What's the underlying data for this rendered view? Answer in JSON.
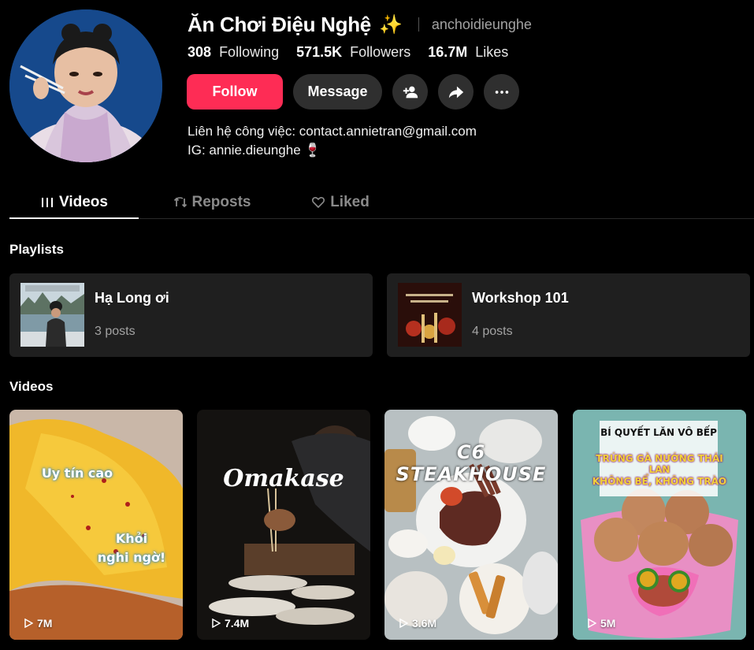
{
  "profile": {
    "display_name": "Ăn Chơi Điệu Nghệ",
    "badge_icon": "sparkles-icon",
    "username": "anchoidieunghe",
    "stats": {
      "following_count": "308",
      "following_label": "Following",
      "followers_count": "571.5K",
      "followers_label": "Followers",
      "likes_count": "16.7M",
      "likes_label": "Likes"
    },
    "bio": {
      "line1": "Liên hệ công việc: contact.annietran@gmail.com",
      "line2": "IG: annie.dieunghe",
      "line2_emoji": "🍷"
    }
  },
  "actions": {
    "follow_label": "Follow",
    "message_label": "Message",
    "add_friend_icon": "person-add-icon",
    "share_icon": "share-icon",
    "more_icon": "more-icon"
  },
  "tabs": [
    {
      "label": "Videos",
      "icon": "grid-icon",
      "active": true
    },
    {
      "label": "Reposts",
      "icon": "repost-icon",
      "active": false
    },
    {
      "label": "Liked",
      "icon": "heart-icon",
      "active": false
    }
  ],
  "playlists_title": "Playlists",
  "playlists": [
    {
      "name": "Hạ Long ơi",
      "count": "3 posts"
    },
    {
      "name": "Workshop 101",
      "count": "4 posts"
    }
  ],
  "videos_title": "Videos",
  "videos": [
    {
      "views": "7M",
      "caption1": "Uy tín cao",
      "caption2": "Khỏi",
      "caption3": "nghi ngờ!"
    },
    {
      "views": "7.4M",
      "caption1": "Omakase"
    },
    {
      "views": "3.6M",
      "caption1": "C6 STEAKHOUSE"
    },
    {
      "views": "5M",
      "caption1": "BÍ QUYẾT LĂN VÔ BẾP",
      "caption2": "TRỨNG GÀ NƯỚNG THÁI LAN",
      "caption3": "KHÔNG BỂ, KHÔNG TRÀO"
    }
  ],
  "colors": {
    "accent": "#fe2c55",
    "background": "#000000",
    "card": "#1f1f1f",
    "button": "#2f2f2f"
  }
}
